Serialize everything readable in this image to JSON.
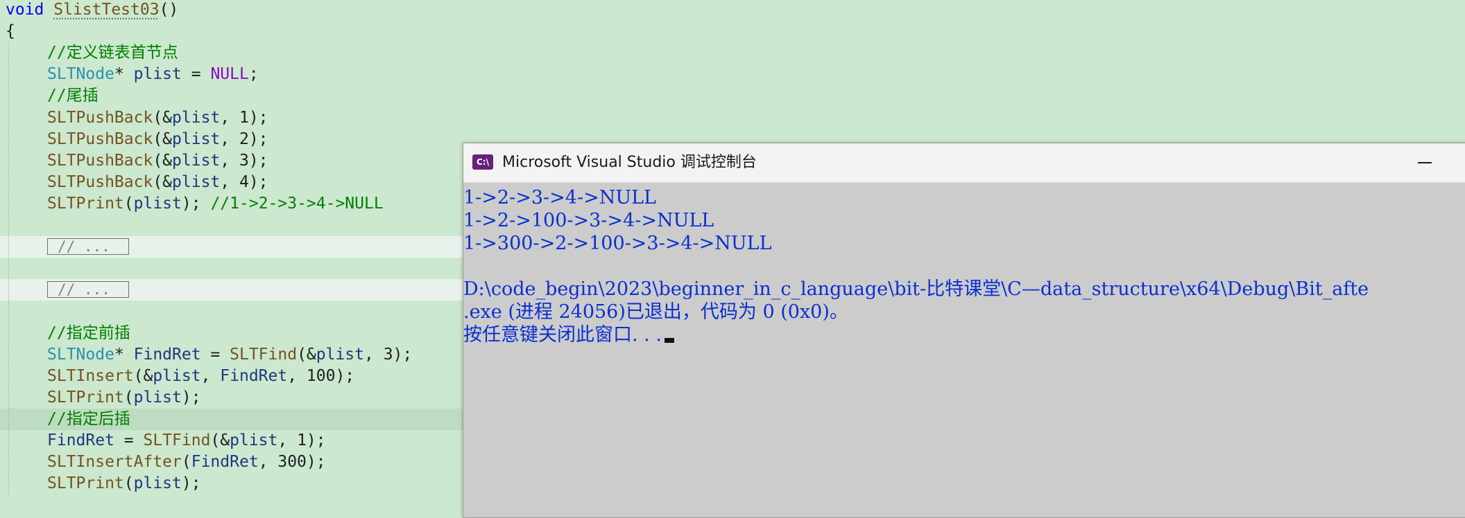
{
  "editor": {
    "lines": [
      {
        "kind": "code",
        "segments": [
          {
            "c": "kw",
            "t": "void"
          },
          {
            "c": "pl",
            "t": " "
          },
          {
            "c": "fn squig",
            "t": "SlistTest03"
          },
          {
            "c": "pl",
            "t": "()"
          }
        ]
      },
      {
        "kind": "code",
        "segments": [
          {
            "c": "pl",
            "t": "{"
          }
        ]
      },
      {
        "kind": "code",
        "segments": [
          {
            "c": "cm",
            "t": "//定义链表首节点"
          }
        ]
      },
      {
        "kind": "code",
        "segments": [
          {
            "c": "ty",
            "t": "SLTNode"
          },
          {
            "c": "pl",
            "t": "* "
          },
          {
            "c": "id",
            "t": "plist"
          },
          {
            "c": "pl",
            "t": " = "
          },
          {
            "c": "mac",
            "t": "NULL"
          },
          {
            "c": "pl",
            "t": ";"
          }
        ]
      },
      {
        "kind": "code",
        "segments": [
          {
            "c": "cm",
            "t": "//尾插"
          }
        ]
      },
      {
        "kind": "code",
        "segments": [
          {
            "c": "fn",
            "t": "SLTPushBack"
          },
          {
            "c": "pl",
            "t": "(&"
          },
          {
            "c": "id",
            "t": "plist"
          },
          {
            "c": "pl",
            "t": ", 1);"
          }
        ]
      },
      {
        "kind": "code",
        "segments": [
          {
            "c": "fn",
            "t": "SLTPushBack"
          },
          {
            "c": "pl",
            "t": "(&"
          },
          {
            "c": "id",
            "t": "plist"
          },
          {
            "c": "pl",
            "t": ", 2);"
          }
        ]
      },
      {
        "kind": "code",
        "segments": [
          {
            "c": "fn",
            "t": "SLTPushBack"
          },
          {
            "c": "pl",
            "t": "(&"
          },
          {
            "c": "id",
            "t": "plist"
          },
          {
            "c": "pl",
            "t": ", 3);"
          }
        ]
      },
      {
        "kind": "code",
        "segments": [
          {
            "c": "fn",
            "t": "SLTPushBack"
          },
          {
            "c": "pl",
            "t": "(&"
          },
          {
            "c": "id",
            "t": "plist"
          },
          {
            "c": "pl",
            "t": ", 4);"
          }
        ]
      },
      {
        "kind": "code",
        "segments": [
          {
            "c": "fn",
            "t": "SLTPrint"
          },
          {
            "c": "pl",
            "t": "("
          },
          {
            "c": "id",
            "t": "plist"
          },
          {
            "c": "pl",
            "t": "); "
          },
          {
            "c": "cm",
            "t": "//1->2->3->4->NULL"
          }
        ]
      },
      {
        "kind": "blank",
        "segments": []
      },
      {
        "kind": "fold",
        "label": "// ..."
      },
      {
        "kind": "blank",
        "segments": []
      },
      {
        "kind": "fold",
        "label": "// ..."
      },
      {
        "kind": "blank",
        "segments": []
      },
      {
        "kind": "code",
        "segments": [
          {
            "c": "cm",
            "t": "//指定前插"
          }
        ]
      },
      {
        "kind": "code",
        "segments": [
          {
            "c": "ty",
            "t": "SLTNode"
          },
          {
            "c": "pl",
            "t": "* "
          },
          {
            "c": "id",
            "t": "FindRet"
          },
          {
            "c": "pl",
            "t": " = "
          },
          {
            "c": "fn",
            "t": "SLTFind"
          },
          {
            "c": "pl",
            "t": "(&"
          },
          {
            "c": "id",
            "t": "plist"
          },
          {
            "c": "pl",
            "t": ", 3);"
          }
        ]
      },
      {
        "kind": "code",
        "segments": [
          {
            "c": "fn",
            "t": "SLTInsert"
          },
          {
            "c": "pl",
            "t": "(&"
          },
          {
            "c": "id",
            "t": "plist"
          },
          {
            "c": "pl",
            "t": ", "
          },
          {
            "c": "id",
            "t": "FindRet"
          },
          {
            "c": "pl",
            "t": ", 100);"
          }
        ]
      },
      {
        "kind": "code",
        "segments": [
          {
            "c": "fn",
            "t": "SLTPrint"
          },
          {
            "c": "pl",
            "t": "("
          },
          {
            "c": "id",
            "t": "plist"
          },
          {
            "c": "pl",
            "t": ");"
          }
        ]
      },
      {
        "kind": "current",
        "segments": [
          {
            "c": "cm",
            "t": "//指定后插"
          }
        ]
      },
      {
        "kind": "code",
        "segments": [
          {
            "c": "id",
            "t": "FindRet"
          },
          {
            "c": "pl",
            "t": " = "
          },
          {
            "c": "fn",
            "t": "SLTFind"
          },
          {
            "c": "pl",
            "t": "(&"
          },
          {
            "c": "id",
            "t": "plist"
          },
          {
            "c": "pl",
            "t": ", 1);"
          }
        ]
      },
      {
        "kind": "code",
        "segments": [
          {
            "c": "fn",
            "t": "SLTInsertAfter"
          },
          {
            "c": "pl",
            "t": "("
          },
          {
            "c": "id",
            "t": "FindRet"
          },
          {
            "c": "pl",
            "t": ", 300);"
          }
        ]
      },
      {
        "kind": "code",
        "segments": [
          {
            "c": "fn",
            "t": "SLTPrint"
          },
          {
            "c": "pl",
            "t": "("
          },
          {
            "c": "id",
            "t": "plist"
          },
          {
            "c": "pl",
            "t": ");"
          }
        ]
      }
    ]
  },
  "console": {
    "icon_label": "C:\\",
    "title": "Microsoft Visual Studio 调试控制台",
    "minimize_icon": "minimize-icon",
    "output": [
      "1->2->3->4->NULL",
      "1->2->100->3->4->NULL",
      "1->300->2->100->3->4->NULL",
      "",
      "D:\\code_begin\\2023\\beginner_in_c_language\\bit-比特课堂\\C—data_structure\\x64\\Debug\\Bit_afte",
      ".exe (进程 24056)已退出，代码为 0 (0x0)。",
      "按任意键关闭此窗口. . ."
    ]
  }
}
